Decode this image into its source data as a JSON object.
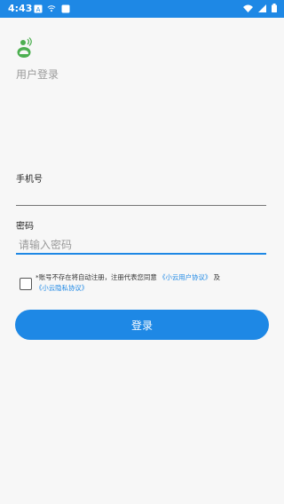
{
  "status_bar": {
    "time": "4:43",
    "accent": "#1e88e5",
    "icons": [
      "notification-a-icon",
      "wifi-calling-icon",
      "sim-icon",
      "wifi-icon",
      "signal-icon",
      "battery-icon"
    ]
  },
  "header": {
    "title": "用户登录",
    "logo_icon": "app-logo-icon"
  },
  "form": {
    "phone_label": "手机号",
    "phone_value": "",
    "password_label": "密码",
    "password_placeholder": "请输入密码"
  },
  "agreement": {
    "checked": false,
    "text_before": "*账号不存在将自动注册，注册代表您同意",
    "user_agreement": "《小云用户协议》",
    "and": "及",
    "privacy_agreement": "《小云隐私协议》"
  },
  "actions": {
    "login_label": "登录"
  }
}
